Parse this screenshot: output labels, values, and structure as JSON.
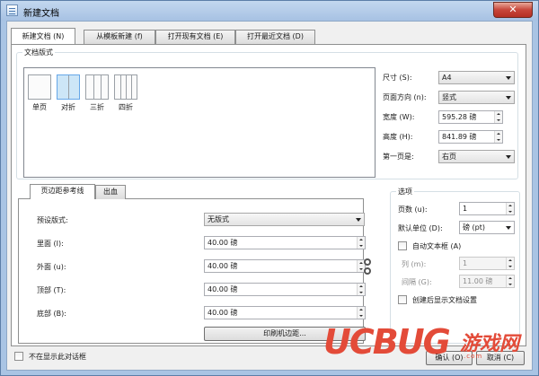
{
  "window": {
    "title": "新建文档",
    "close_label": "✕"
  },
  "tabs": [
    {
      "label": "新建文档 (N)"
    },
    {
      "label": "从模板新建 (f)"
    },
    {
      "label": "打开现有文档 (E)"
    },
    {
      "label": "打开最近文档 (D)"
    }
  ],
  "document_layout": {
    "group_title": "文档版式",
    "items": [
      {
        "label": "单页"
      },
      {
        "label": "对折"
      },
      {
        "label": "三折"
      },
      {
        "label": "四折"
      }
    ],
    "selected": "对折"
  },
  "page_props": {
    "size_label": "尺寸 (S):",
    "size_value": "A4",
    "orientation_label": "页面方向 (n):",
    "orientation_value": "竖式",
    "width_label": "宽度 (W):",
    "width_value": "595.28 磅",
    "height_label": "高度 (H):",
    "height_value": "841.89 磅",
    "first_page_label": "第一页是:",
    "first_page_value": "右页"
  },
  "margins_tabs": [
    {
      "label": "页边距参考线"
    },
    {
      "label": "出血"
    }
  ],
  "margins": {
    "preset_label": "预设版式:",
    "preset_value": "无版式",
    "inside_label": "里面 (I):",
    "inside_value": "40.00 磅",
    "outside_label": "外面 (u):",
    "outside_value": "40.00 磅",
    "top_label": "顶部 (T):",
    "top_value": "40.00 磅",
    "bottom_label": "底部 (B):",
    "bottom_value": "40.00 磅",
    "printer_margins_label": "印刷机边距..."
  },
  "options": {
    "group_title": "选项",
    "pages_label": "页数 (u):",
    "pages_value": "1",
    "unit_label": "默认单位 (D):",
    "unit_value": "磅 (pt)",
    "auto_textframe_label": "自动文本框 (A)",
    "columns_label": "列 (m):",
    "columns_value": "1",
    "gap_label": "间隔 (G):",
    "gap_value": "11.00 磅",
    "show_settings_label": "创建后显示文档设置"
  },
  "footer": {
    "dont_show_label": "不在显示此对话框",
    "ok_label": "确认 (O)",
    "cancel_label": "取消 (C)"
  },
  "watermark": {
    "brand": "UCBUG",
    "cn": "游戏网",
    "url": ".com"
  }
}
